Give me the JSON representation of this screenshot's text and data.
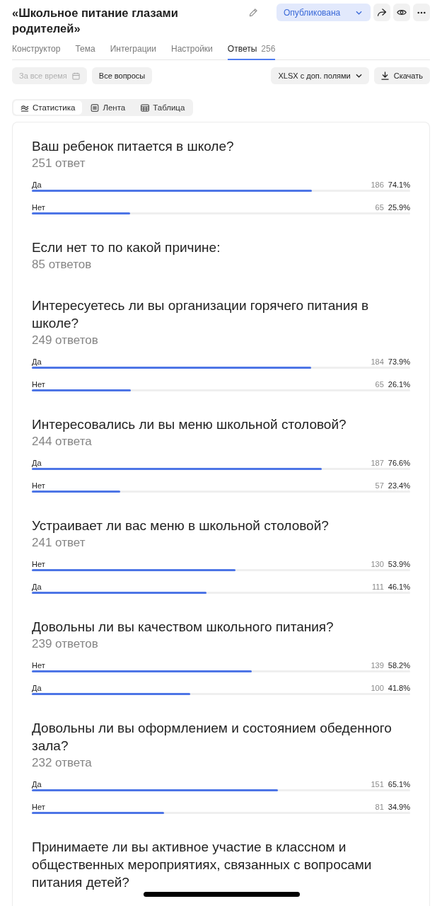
{
  "header": {
    "title": "«Школьное питание глазами родителей»",
    "status": "Опубликована"
  },
  "tabs": [
    {
      "label": "Конструктор",
      "selected": false
    },
    {
      "label": "Тема",
      "selected": false
    },
    {
      "label": "Интеграции",
      "selected": false
    },
    {
      "label": "Настройки",
      "selected": false
    },
    {
      "label": "Ответы",
      "count": "256",
      "selected": true
    }
  ],
  "toolbar": {
    "period": {
      "label": "За все время",
      "disabled": true
    },
    "questions_filter": "Все вопросы",
    "export_format": "XLSX с доп. полями",
    "download": "Скачать"
  },
  "views": [
    {
      "label": "Статистика",
      "kind": "statistics",
      "selected": true
    },
    {
      "label": "Лента",
      "kind": "feed",
      "selected": false
    },
    {
      "label": "Таблица",
      "kind": "table",
      "selected": false
    }
  ],
  "questions": [
    {
      "title": "Ваш ребенок питается в школе?",
      "count": "251 ответ",
      "options": [
        {
          "label": "Да",
          "count": "186",
          "percent": "74.1%",
          "level": 0.741
        },
        {
          "label": "Нет",
          "count": "65",
          "percent": "25.9%",
          "level": 0.259
        }
      ]
    },
    {
      "title": "Если нет то по какой причине:",
      "count": "85 ответов"
    },
    {
      "title": "Интересуетесь ли вы организации горячего питания в школе?",
      "count": "249 ответов",
      "options": [
        {
          "label": "Да",
          "count": "184",
          "percent": "73.9%",
          "level": 0.739
        },
        {
          "label": "Нет",
          "count": "65",
          "percent": "26.1%",
          "level": 0.261
        }
      ]
    },
    {
      "title": "Интересовались ли вы меню школьной столовой?",
      "count": "244 ответа",
      "options": [
        {
          "label": "Да",
          "count": "187",
          "percent": "76.6%",
          "level": 0.766
        },
        {
          "label": "Нет",
          "count": "57",
          "percent": "23.4%",
          "level": 0.234
        }
      ]
    },
    {
      "title": "Устраивает ли вас меню в школьной столовой?",
      "count": "241 ответ",
      "options": [
        {
          "label": "Нет",
          "count": "130",
          "percent": "53.9%",
          "level": 0.539
        },
        {
          "label": "Да",
          "count": "111",
          "percent": "46.1%",
          "level": 0.461
        }
      ]
    },
    {
      "title": "Довольны ли вы качеством школьного питания?",
      "count": "239 ответов",
      "options": [
        {
          "label": "Нет",
          "count": "139",
          "percent": "58.2%",
          "level": 0.582
        },
        {
          "label": "Да",
          "count": "100",
          "percent": "41.8%",
          "level": 0.418
        }
      ]
    },
    {
      "title": "Довольны ли вы оформлением и состоянием обеденного зала?",
      "count": "232 ответа",
      "options": [
        {
          "label": "Да",
          "count": "151",
          "percent": "65.1%",
          "level": 0.651
        },
        {
          "label": "Нет",
          "count": "81",
          "percent": "34.9%",
          "level": 0.349
        }
      ]
    },
    {
      "title": "Принимаете ли вы активное участие в классном и общественных мероприятиях, связанных с вопросами питания детей?"
    }
  ]
}
